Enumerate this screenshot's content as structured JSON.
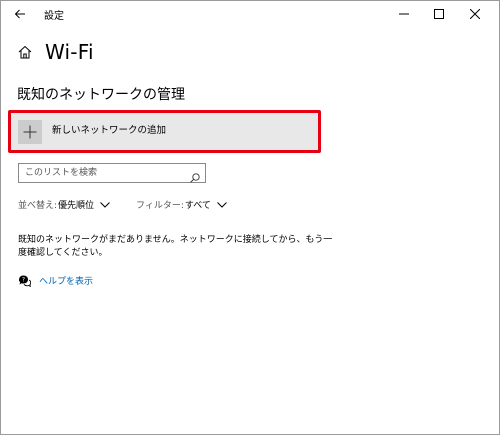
{
  "window": {
    "title": "設定",
    "back_icon": "back-arrow-icon",
    "controls": [
      "minimize-icon",
      "maximize-icon",
      "close-icon"
    ]
  },
  "header": {
    "home_icon": "home-icon",
    "title": "Wi-Fi"
  },
  "section": {
    "heading": "既知のネットワークの管理"
  },
  "add_network": {
    "icon": "plus-icon",
    "label": "新しいネットワークの追加",
    "highlight_color": "#e60012"
  },
  "search": {
    "placeholder": "このリストを検索",
    "value": "",
    "icon": "search-icon"
  },
  "sort": {
    "label": "並べ替え:",
    "value": "優先順位"
  },
  "filter": {
    "label": "フィルター:",
    "value": "すべて"
  },
  "empty_message": "既知のネットワークがまだありません。ネットワークに接続してから、もう一度確認してください。",
  "help": {
    "icon": "help-chat-icon",
    "label": "ヘルプを表示",
    "link_color": "#0063b1"
  }
}
